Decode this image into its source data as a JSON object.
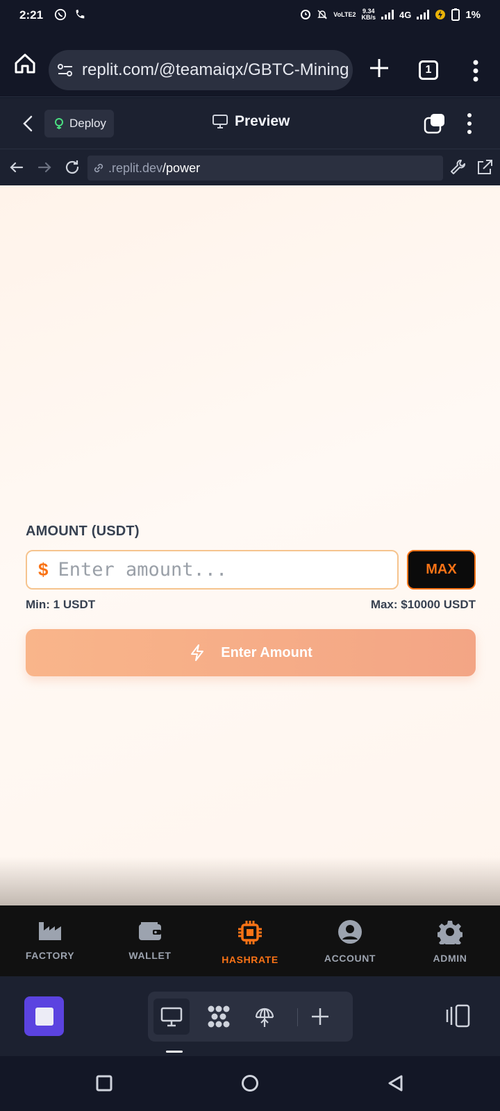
{
  "status_bar": {
    "time": "2:21",
    "lte": "VoLTE2",
    "speed_value": "9.34",
    "speed_unit": "KB/s",
    "network": "4G",
    "battery": "1%"
  },
  "browser": {
    "url": "replit.com/@teamaiqx/GBTC-Mining",
    "tab_count": "1"
  },
  "replit": {
    "deploy_label": "Deploy",
    "preview_label": "Preview"
  },
  "webview": {
    "domain": ".replit.dev",
    "path": "/power"
  },
  "form": {
    "amount_label": "AMOUNT (USDT)",
    "currency_symbol": "$",
    "amount_placeholder": "Enter amount...",
    "max_label": "MAX",
    "min_text": "Min: 1 USDT",
    "max_text": "Max: $10000 USDT",
    "submit_label": "Enter Amount"
  },
  "app_nav": {
    "items": [
      {
        "label": "FACTORY",
        "icon": "factory-icon"
      },
      {
        "label": "WALLET",
        "icon": "wallet-icon"
      },
      {
        "label": "HASHRATE",
        "icon": "cpu-icon",
        "active": true
      },
      {
        "label": "ACCOUNT",
        "icon": "account-icon"
      },
      {
        "label": "ADMIN",
        "icon": "gear-icon"
      }
    ]
  },
  "colors": {
    "accent": "#f97316",
    "submit_bg": "#f9b58a",
    "replit_stop": "#5b43e0"
  }
}
